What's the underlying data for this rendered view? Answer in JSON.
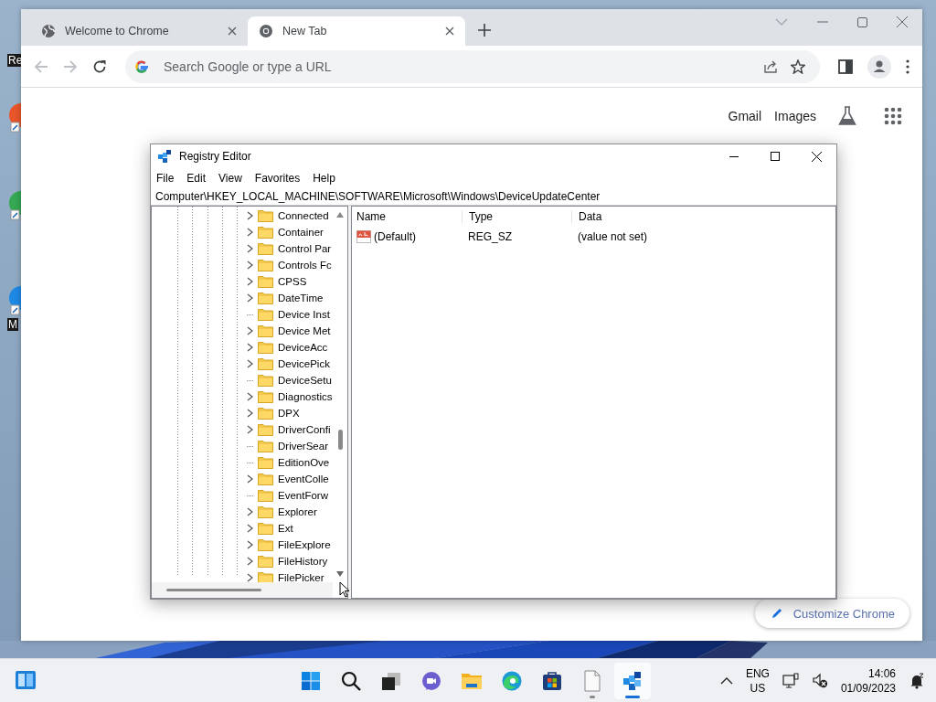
{
  "desktop": {
    "shortcuts": [
      {
        "label": "Re"
      },
      {
        "color": "#e8552a"
      },
      {
        "color": "#34a853"
      },
      {
        "label": "M",
        "color": "#1e88e5"
      }
    ]
  },
  "browser": {
    "tabs": [
      {
        "title": "Welcome to Chrome",
        "selected": false
      },
      {
        "title": "New Tab",
        "selected": true
      }
    ],
    "omnibox": {
      "placeholder": "Search Google or type a URL"
    },
    "links": [
      "Gmail",
      "Images"
    ],
    "customize_button": "Customize Chrome"
  },
  "registry_editor": {
    "title": "Registry Editor",
    "menu": [
      "File",
      "Edit",
      "View",
      "Favorites",
      "Help"
    ],
    "address": "Computer\\HKEY_LOCAL_MACHINE\\SOFTWARE\\Microsoft\\Windows\\DeviceUpdateCenter",
    "tree": [
      {
        "name": "Connected",
        "has_children": true
      },
      {
        "name": "Container",
        "has_children": true
      },
      {
        "name": "Control Par",
        "has_children": true
      },
      {
        "name": "Controls Fc",
        "has_children": true
      },
      {
        "name": "CPSS",
        "has_children": true
      },
      {
        "name": "DateTime",
        "has_children": true
      },
      {
        "name": "Device Inst",
        "has_children": false
      },
      {
        "name": "Device Met",
        "has_children": true
      },
      {
        "name": "DeviceAcc",
        "has_children": true
      },
      {
        "name": "DevicePick",
        "has_children": true
      },
      {
        "name": "DeviceSetu",
        "has_children": false
      },
      {
        "name": "Diagnostics",
        "has_children": true
      },
      {
        "name": "DPX",
        "has_children": true
      },
      {
        "name": "DriverConfi",
        "has_children": true
      },
      {
        "name": "DriverSear",
        "has_children": false
      },
      {
        "name": "EditionOve",
        "has_children": false
      },
      {
        "name": "EventColle",
        "has_children": true
      },
      {
        "name": "EventForw",
        "has_children": false
      },
      {
        "name": "Explorer",
        "has_children": true
      },
      {
        "name": "Ext",
        "has_children": true
      },
      {
        "name": "FileExplore",
        "has_children": true
      },
      {
        "name": "FileHistory",
        "has_children": true
      },
      {
        "name": "FilePicker",
        "has_children": true
      }
    ],
    "columns": [
      "Name",
      "Type",
      "Data"
    ],
    "values": [
      {
        "name": "(Default)",
        "type": "REG_SZ",
        "data": "(value not set)"
      }
    ]
  },
  "taskbar": {
    "apps": [
      {
        "kind": "start",
        "running": false,
        "active": false
      },
      {
        "kind": "search",
        "running": false,
        "active": false
      },
      {
        "kind": "taskview",
        "running": false,
        "active": false
      },
      {
        "kind": "chat",
        "running": false,
        "active": false
      },
      {
        "kind": "explorer",
        "running": false,
        "active": false
      },
      {
        "kind": "edge",
        "running": false,
        "active": false
      },
      {
        "kind": "store",
        "running": false,
        "active": false
      },
      {
        "kind": "notepad",
        "running": true,
        "active": false
      },
      {
        "kind": "regedit",
        "running": true,
        "active": true
      }
    ],
    "language": "ENG",
    "region": "US",
    "time": "14:06",
    "date": "01/09/2023"
  }
}
